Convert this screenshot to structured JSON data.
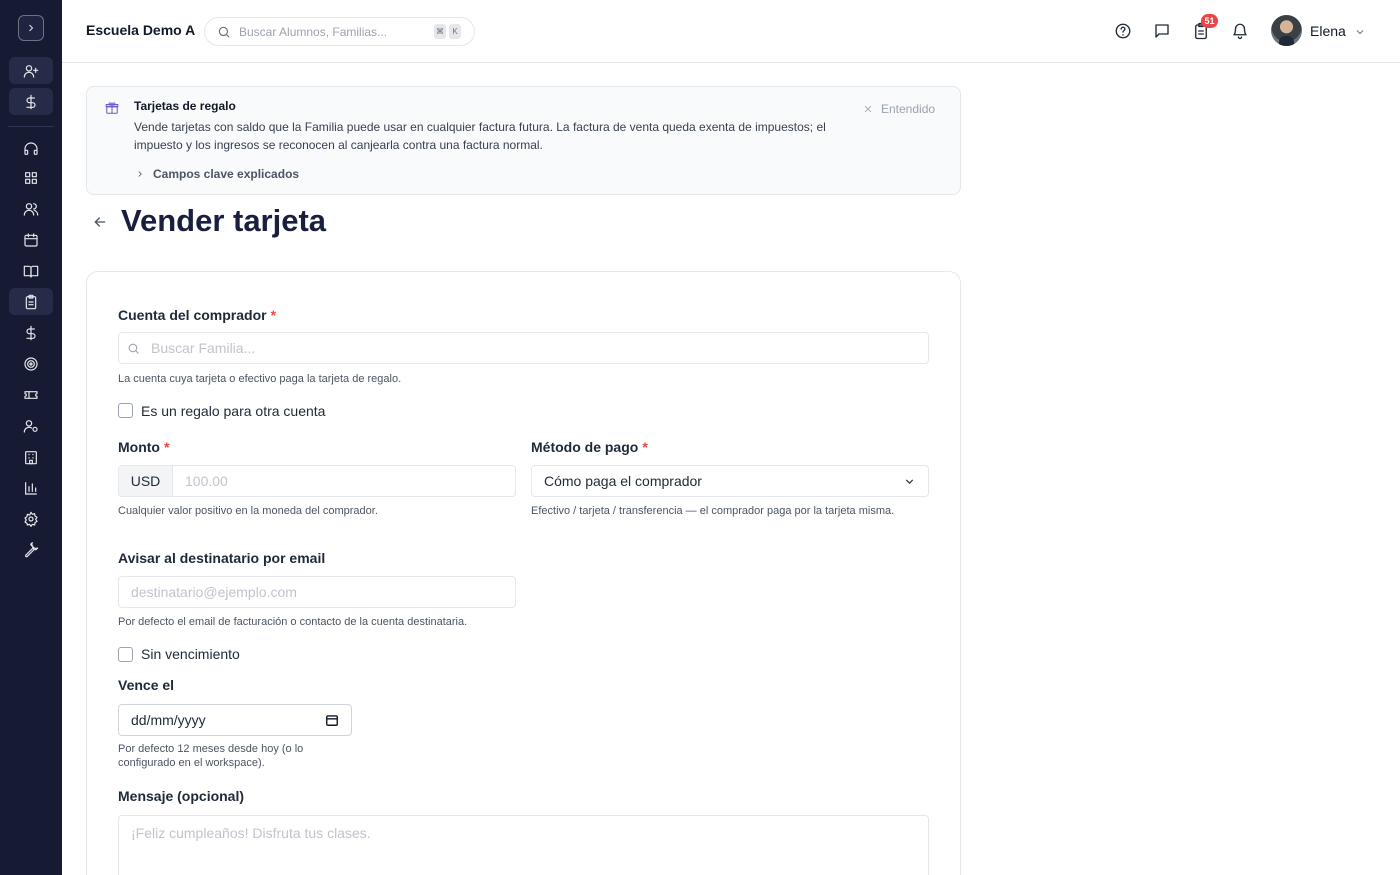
{
  "sidebar": {
    "toggle_icon": "chevron-right-icon",
    "items": [
      {
        "icon": "user-plus-icon"
      },
      {
        "icon": "dollar-icon"
      },
      {
        "icon": "headset-icon"
      },
      {
        "icon": "grid-icon"
      },
      {
        "icon": "users-icon"
      },
      {
        "icon": "calendar-icon"
      },
      {
        "icon": "book-open-icon"
      },
      {
        "icon": "clipboard-icon",
        "active": true
      },
      {
        "icon": "dollar-icon"
      },
      {
        "icon": "target-icon"
      },
      {
        "icon": "ticket-icon"
      },
      {
        "icon": "user-cog-icon"
      },
      {
        "icon": "building-icon"
      },
      {
        "icon": "bar-chart-icon"
      },
      {
        "icon": "gear-icon"
      },
      {
        "icon": "wrench-icon"
      }
    ]
  },
  "header": {
    "school_name": "Escuela Demo A",
    "search_placeholder": "Buscar Alumnos, Familias...",
    "shortcut_keys": [
      "⌘",
      "K"
    ],
    "tasks_badge": "51",
    "user_name": "Elena"
  },
  "banner": {
    "title": "Tarjetas de regalo",
    "text": "Vende tarjetas con saldo que la Familia puede usar en cualquier factura futura. La factura de venta queda exenta de impuestos; el impuesto y los ingresos se reconocen al canjearla contra una factura normal.",
    "dismiss_label": "Entendido",
    "expand_label": "Campos clave explicados"
  },
  "page": {
    "title": "Vender tarjeta"
  },
  "form": {
    "buyer": {
      "label": "Cuenta del comprador",
      "required": "*",
      "placeholder": "Buscar Familia...",
      "help": "La cuenta cuya tarjeta o efectivo paga la tarjeta de regalo."
    },
    "gift_other": {
      "label": "Es un regalo para otra cuenta"
    },
    "amount": {
      "label": "Monto",
      "required": "*",
      "currency": "USD",
      "placeholder": "100.00",
      "help": "Cualquier valor positivo en la moneda del comprador."
    },
    "payment_method": {
      "label": "Método de pago",
      "required": "*",
      "selected": "Cómo paga el comprador",
      "help": "Efectivo / tarjeta / transferencia — el comprador paga por la tarjeta misma."
    },
    "notify_email": {
      "label": "Avisar al destinatario por email",
      "placeholder": "destinatario@ejemplo.com",
      "help": "Por defecto el email de facturación o contacto de la cuenta destinataria."
    },
    "no_expiry": {
      "label": "Sin vencimiento"
    },
    "expires": {
      "label": "Vence el",
      "placeholder": "dd/mm/yyyy",
      "help": "Por defecto 12 meses desde hoy (o lo configurado en el workspace)."
    },
    "message": {
      "label": "Mensaje (opcional)",
      "placeholder": "¡Feliz cumpleaños! Disfruta tus clases."
    }
  }
}
